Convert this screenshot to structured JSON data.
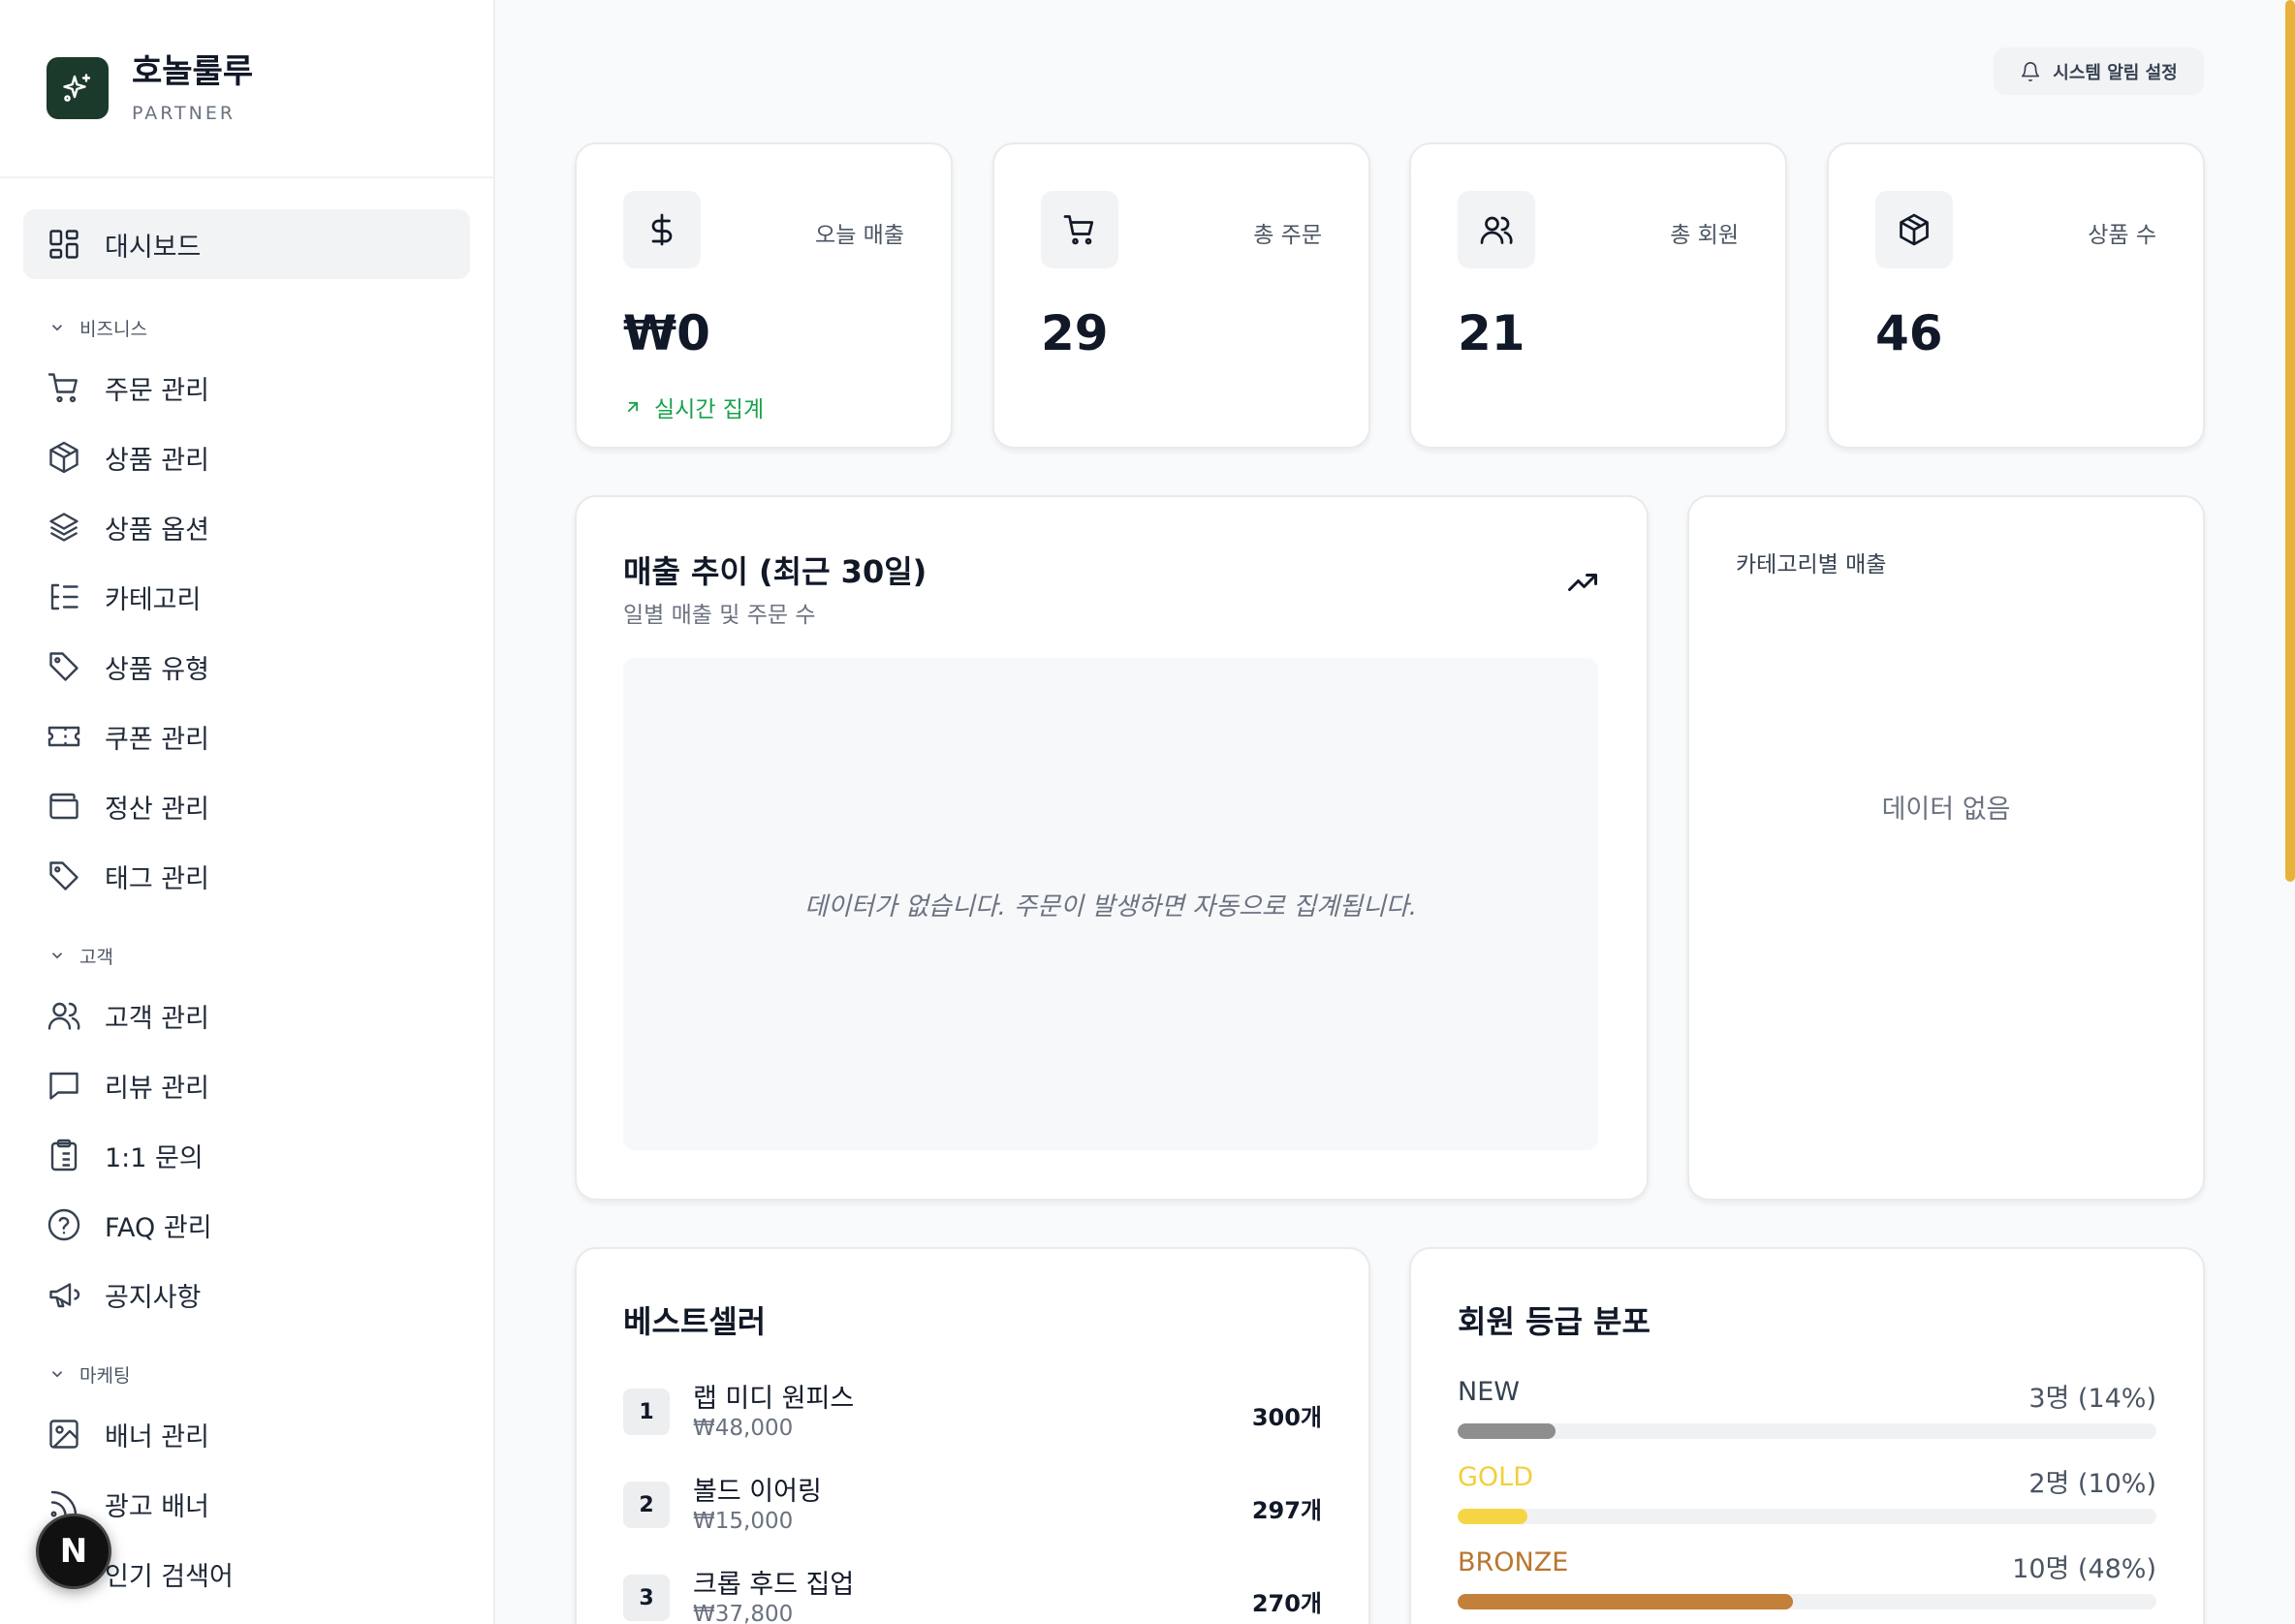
{
  "brand": {
    "name": "호놀룰루",
    "sub": "PARTNER"
  },
  "nav": {
    "dashboard": "대시보드",
    "groups": {
      "business": "비즈니스",
      "customer": "고객",
      "marketing": "마케팅"
    },
    "business_items": [
      "주문 관리",
      "상품 관리",
      "상품 옵션",
      "카테고리",
      "상품 유형",
      "쿠폰 관리",
      "정산 관리",
      "태그 관리"
    ],
    "customer_items": [
      "고객 관리",
      "리뷰 관리",
      "1:1 문의",
      "FAQ 관리",
      "공지사항"
    ],
    "marketing_items": [
      "배너 관리",
      "광고 배너",
      "인기 검색어"
    ]
  },
  "fab_label": "N",
  "header": {
    "alert_settings": "시스템 알림 설정"
  },
  "stats": [
    {
      "label": "오늘 매출",
      "value": "₩0",
      "trend": "실시간 집계",
      "icon": "dollar-icon"
    },
    {
      "label": "총 주문",
      "value": "29",
      "icon": "cart-icon"
    },
    {
      "label": "총 회원",
      "value": "21",
      "icon": "users-icon"
    },
    {
      "label": "상품 수",
      "value": "46",
      "icon": "package-icon"
    }
  ],
  "sales_trend": {
    "title": "매출 추이 (최근 30일)",
    "subtitle": "일별 매출 및 주문 수",
    "empty": "데이터가 없습니다. 주문이 발생하면 자동으로 집계됩니다."
  },
  "category_sales": {
    "title": "카테고리별 매출",
    "empty": "데이터 없음"
  },
  "bestseller": {
    "title": "베스트셀러",
    "items": [
      {
        "rank": "1",
        "name": "랩 미디 원피스",
        "price": "₩48,000",
        "qty": "300개"
      },
      {
        "rank": "2",
        "name": "볼드 이어링",
        "price": "₩15,000",
        "qty": "297개"
      },
      {
        "rank": "3",
        "name": "크롭 후드 집업",
        "price": "₩37,800",
        "qty": "270개"
      }
    ]
  },
  "grades": {
    "title": "회원 등급 분포",
    "items": [
      {
        "name": "NEW",
        "count": "3명 (14%)",
        "percent": 14,
        "color": "#8e8e8e",
        "text_color": "#374151"
      },
      {
        "name": "GOLD",
        "count": "2명 (10%)",
        "percent": 10,
        "color": "#f6d545",
        "text_color": "#f2cf3b"
      },
      {
        "name": "BRONZE",
        "count": "10명 (48%)",
        "percent": 48,
        "color": "#c2803a",
        "text_color": "#b8762f"
      }
    ]
  },
  "colors": {
    "accent": "#1c3a2b",
    "trend_green": "#16a34a",
    "scrollbar": "#e8b13a"
  }
}
